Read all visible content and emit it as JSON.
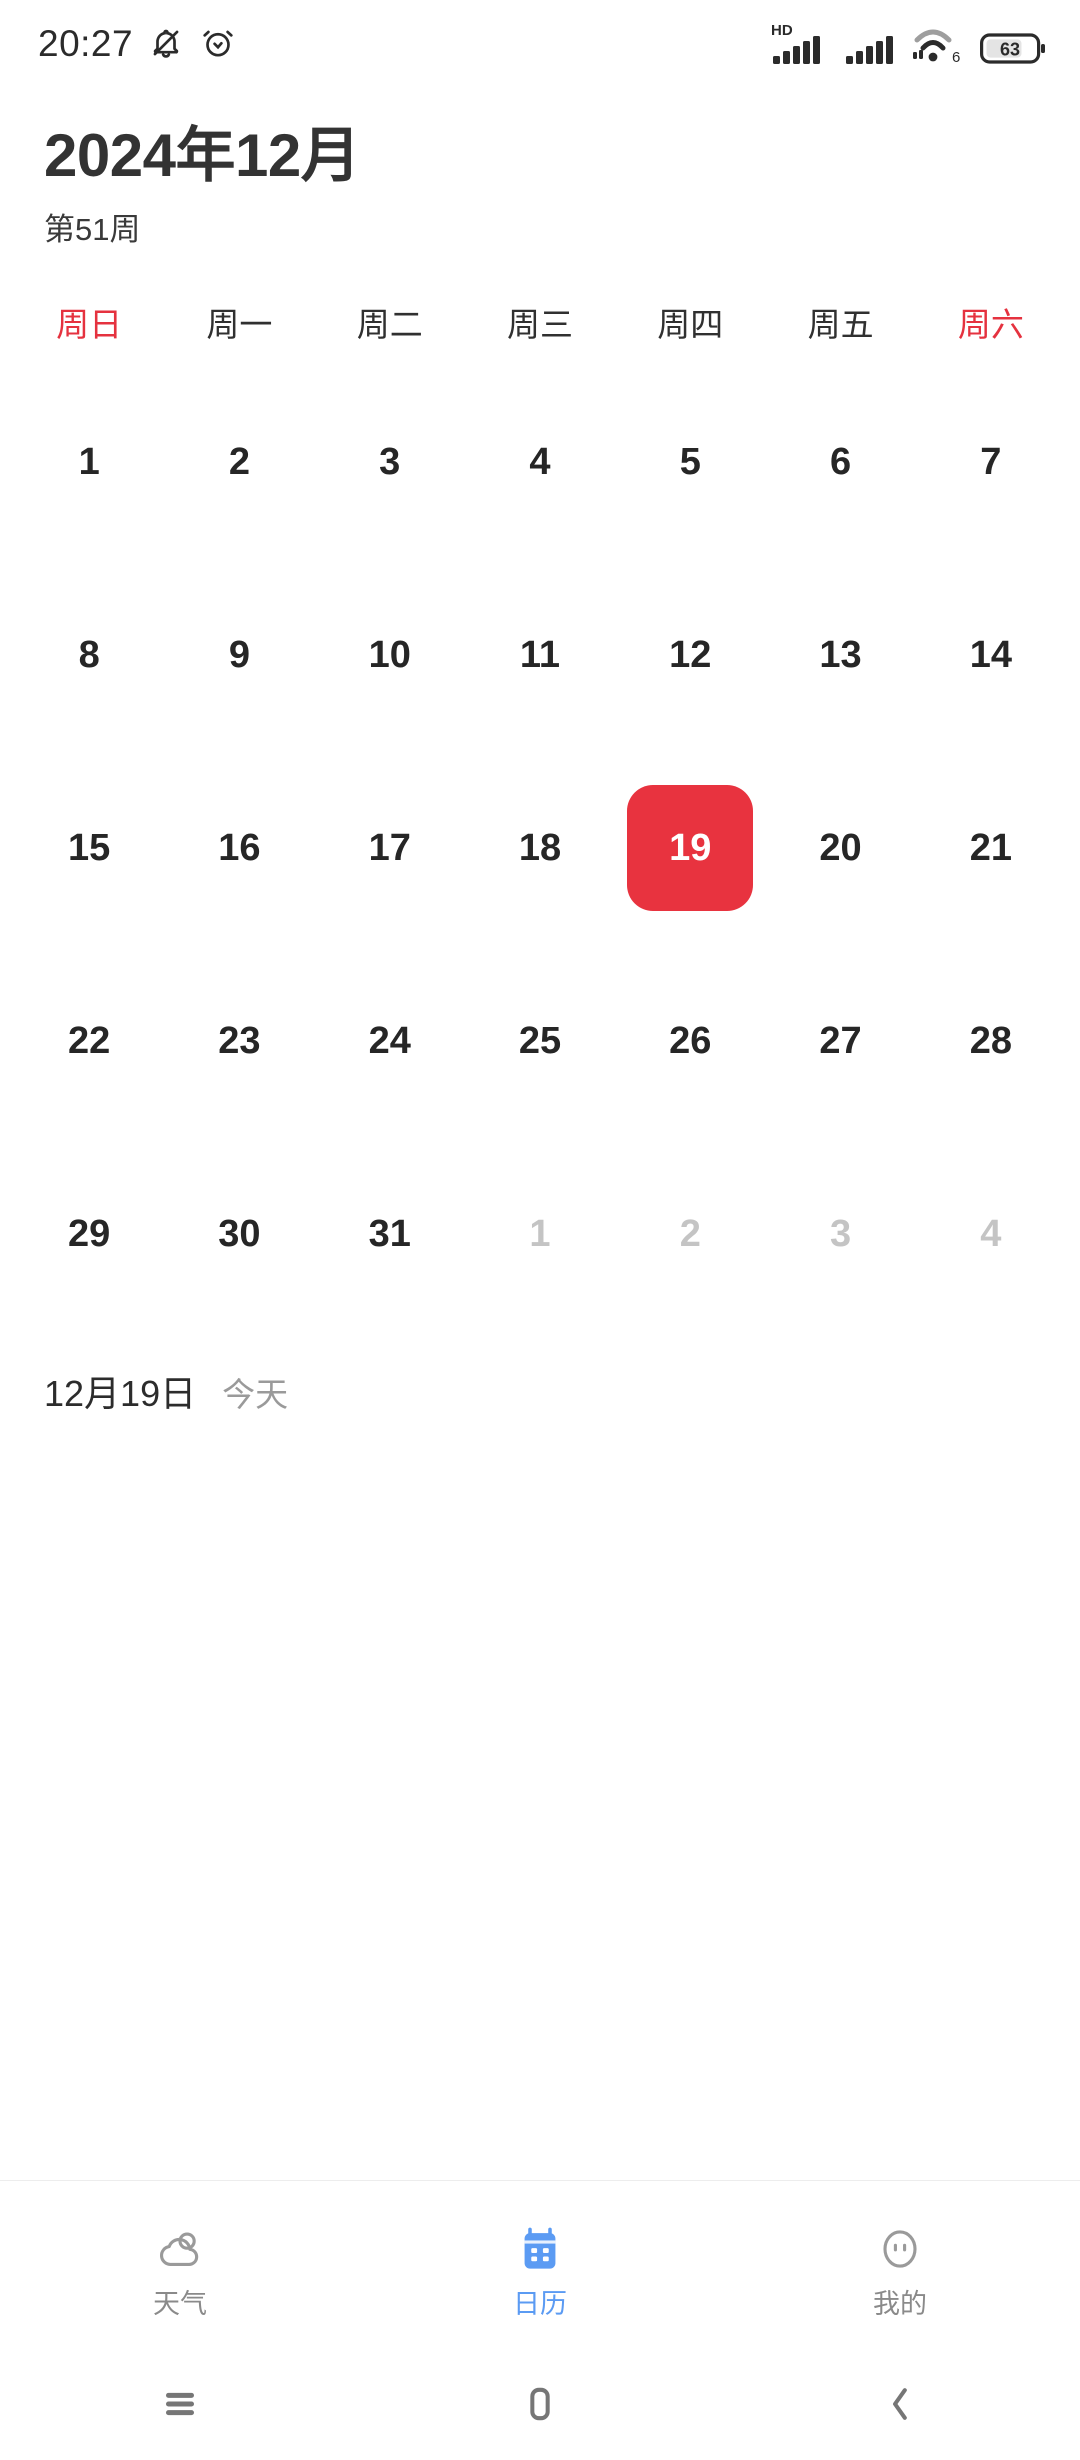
{
  "status_bar": {
    "time": "20:27",
    "left_icons": [
      {
        "name": "bell-muted-icon"
      },
      {
        "name": "alarm-clock-icon"
      }
    ],
    "right_icons": [
      {
        "name": "signal-hd-icon",
        "label": "HD"
      },
      {
        "name": "signal-bars-icon"
      },
      {
        "name": "wifi-icon",
        "label": "6"
      },
      {
        "name": "battery-icon",
        "label": "63"
      }
    ],
    "battery_percent": "63",
    "wifi_generation": "6",
    "hd_label": "HD"
  },
  "header": {
    "month_title": "2024年12月",
    "week_label": "第51周"
  },
  "weekdays": [
    {
      "label": "周日",
      "weekend": true
    },
    {
      "label": "周一",
      "weekend": false
    },
    {
      "label": "周二",
      "weekend": false
    },
    {
      "label": "周三",
      "weekend": false
    },
    {
      "label": "周四",
      "weekend": false
    },
    {
      "label": "周五",
      "weekend": false
    },
    {
      "label": "周六",
      "weekend": true
    }
  ],
  "days": [
    {
      "label": "1",
      "state": "normal"
    },
    {
      "label": "2",
      "state": "normal"
    },
    {
      "label": "3",
      "state": "normal"
    },
    {
      "label": "4",
      "state": "normal"
    },
    {
      "label": "5",
      "state": "normal"
    },
    {
      "label": "6",
      "state": "normal"
    },
    {
      "label": "7",
      "state": "normal"
    },
    {
      "label": "8",
      "state": "normal"
    },
    {
      "label": "9",
      "state": "normal"
    },
    {
      "label": "10",
      "state": "normal"
    },
    {
      "label": "11",
      "state": "normal"
    },
    {
      "label": "12",
      "state": "normal"
    },
    {
      "label": "13",
      "state": "normal"
    },
    {
      "label": "14",
      "state": "normal"
    },
    {
      "label": "15",
      "state": "normal"
    },
    {
      "label": "16",
      "state": "normal"
    },
    {
      "label": "17",
      "state": "normal"
    },
    {
      "label": "18",
      "state": "normal"
    },
    {
      "label": "19",
      "state": "today"
    },
    {
      "label": "20",
      "state": "normal"
    },
    {
      "label": "21",
      "state": "normal"
    },
    {
      "label": "22",
      "state": "normal"
    },
    {
      "label": "23",
      "state": "normal"
    },
    {
      "label": "24",
      "state": "normal"
    },
    {
      "label": "25",
      "state": "normal"
    },
    {
      "label": "26",
      "state": "normal"
    },
    {
      "label": "27",
      "state": "normal"
    },
    {
      "label": "28",
      "state": "normal"
    },
    {
      "label": "29",
      "state": "normal"
    },
    {
      "label": "30",
      "state": "normal"
    },
    {
      "label": "31",
      "state": "normal"
    },
    {
      "label": "1",
      "state": "muted"
    },
    {
      "label": "2",
      "state": "muted"
    },
    {
      "label": "3",
      "state": "muted"
    },
    {
      "label": "4",
      "state": "muted"
    }
  ],
  "selected": {
    "date_text": "12月19日",
    "today_text": "今天"
  },
  "tabs": [
    {
      "label": "天气",
      "icon": "cloud-icon",
      "active": false
    },
    {
      "label": "日历",
      "icon": "calendar-icon",
      "active": true
    },
    {
      "label": "我的",
      "icon": "face-icon",
      "active": false
    }
  ],
  "nav_bar": [
    {
      "name": "recents-button"
    },
    {
      "name": "home-button"
    },
    {
      "name": "back-button"
    }
  ],
  "colors": {
    "today_red": "#e8333f",
    "weekend_red": "#e5323f",
    "active_tab_blue": "#5b9bf3",
    "text_primary": "#262626",
    "text_muted": "#c4c4c4",
    "background": "#ffffff"
  }
}
